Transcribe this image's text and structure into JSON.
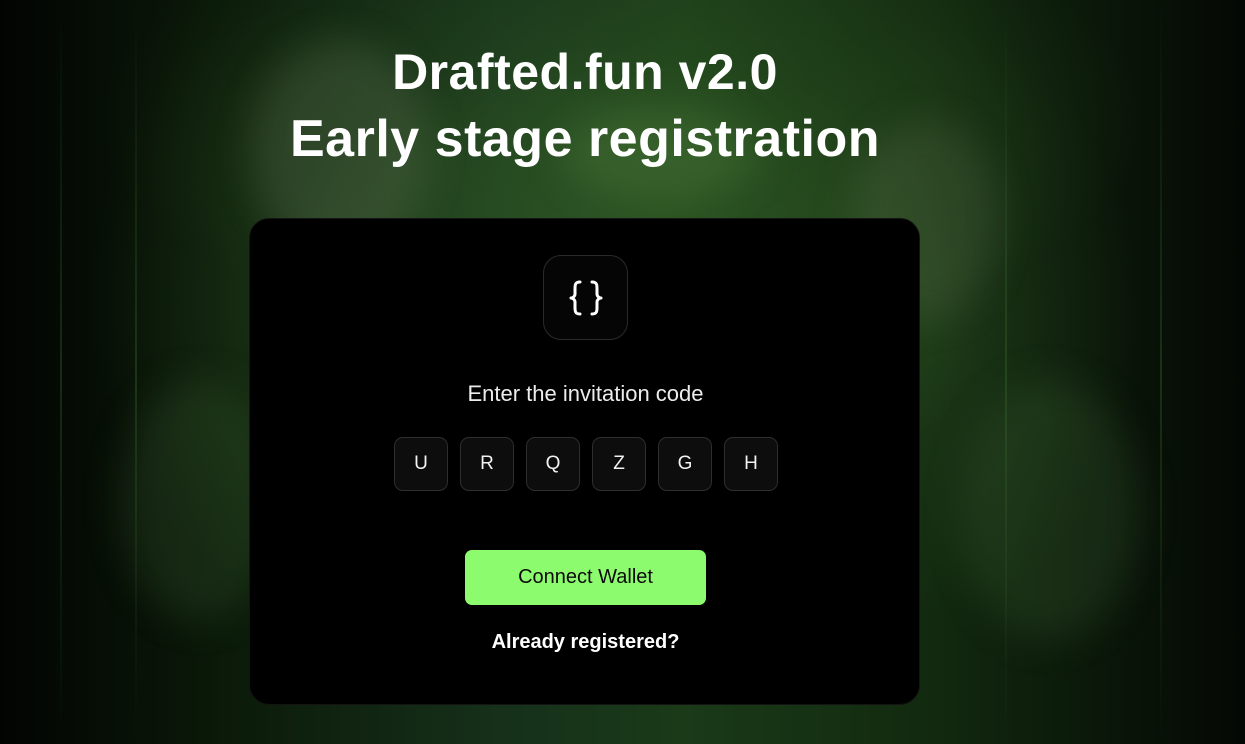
{
  "header": {
    "title_line_1": "Drafted.fun v2.0",
    "title_line_2": "Early stage registration"
  },
  "card": {
    "icon": "curly-braces-icon",
    "prompt": "Enter the invitation code",
    "code_characters": [
      "U",
      "R",
      "Q",
      "Z",
      "G",
      "H"
    ],
    "connect_button_label": "Connect Wallet",
    "already_registered_link": "Already registered?"
  },
  "colors": {
    "accent": "#8dfb6e",
    "card_background": "#000000",
    "page_background": "#1a3a18"
  }
}
